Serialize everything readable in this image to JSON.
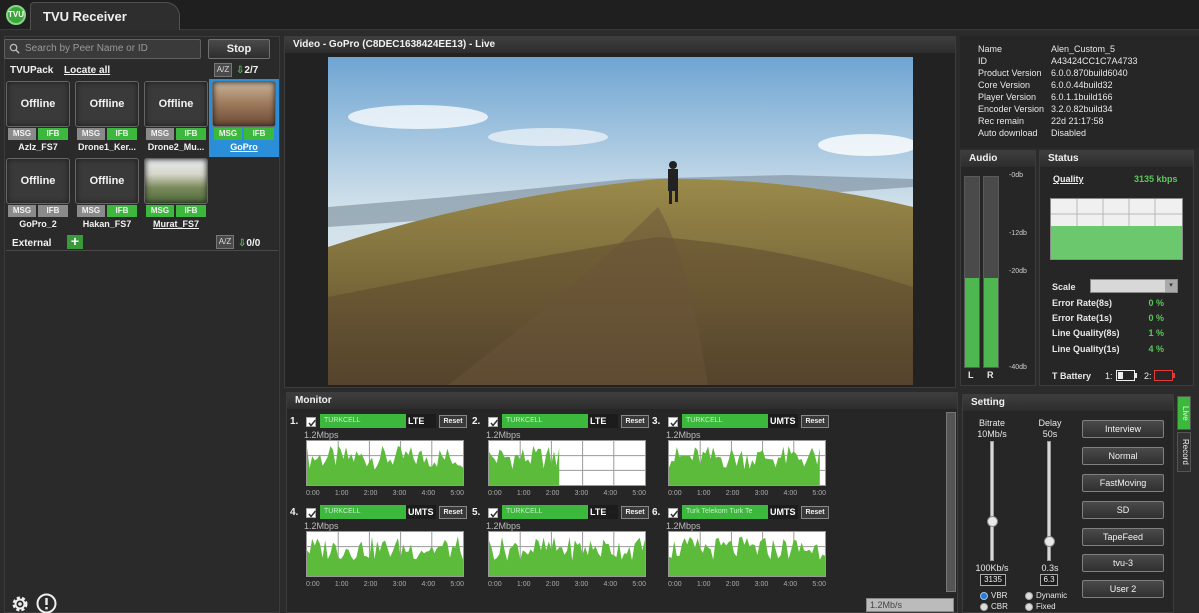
{
  "app": {
    "logo": "TVU",
    "title": "TVU Receiver"
  },
  "sidebar": {
    "search_placeholder": "Search by Peer Name or ID",
    "stop_label": "Stop",
    "tvupack_label": "TVUPack",
    "locate_label": "Locate all",
    "sort_label": "A/Z",
    "tvupack_count": "2/7",
    "external_label": "External",
    "external_count": "0/0",
    "peers": [
      {
        "status": "Offline",
        "msg": "MSG",
        "ifb": "IFB",
        "name": "Azlz_FS7"
      },
      {
        "status": "Offline",
        "msg": "MSG",
        "ifb": "IFB",
        "name": "Drone1_Ker..."
      },
      {
        "status": "Offline",
        "msg": "MSG",
        "ifb": "IFB",
        "name": "Drone2_Mu..."
      },
      {
        "status": "",
        "msg": "MSG",
        "ifb": "IFB",
        "name": "GoPro"
      },
      {
        "status": "Offline",
        "msg": "MSG",
        "ifb": "IFB",
        "name": "GoPro_2"
      },
      {
        "status": "Offline",
        "msg": "MSG",
        "ifb": "IFB",
        "name": "Hakan_FS7"
      },
      {
        "status": "",
        "msg": "MSG",
        "ifb": "IFB",
        "name": "Murat_FS7"
      }
    ]
  },
  "video": {
    "title": "Video - GoPro (C8DEC1638424EE13) - Live"
  },
  "info": [
    {
      "key": "Name",
      "value": "Alen_Custom_5"
    },
    {
      "key": "ID",
      "value": "A43424CC1C7A4733"
    },
    {
      "key": "Product Version",
      "value": "6.0.0.870build6040"
    },
    {
      "key": "Core Version",
      "value": "6.0.0.44build32"
    },
    {
      "key": "Player Version",
      "value": "6.0.1.1build166"
    },
    {
      "key": "Encoder Version",
      "value": "3.2.0.82build34"
    },
    {
      "key": "Rec remain",
      "value": "22d 21:17:58"
    },
    {
      "key": "Auto download",
      "value": "Disabled"
    }
  ],
  "audio": {
    "title": "Audio",
    "db_labels": [
      "-0db",
      "-12db",
      "-20db",
      "-40db"
    ],
    "left_label": "L",
    "right_label": "R",
    "left_level": 0.47,
    "right_level": 0.47
  },
  "status": {
    "title": "Status",
    "quality_label": "Quality",
    "quality_value": "3135 kbps",
    "quality_fill": 0.55,
    "scale_label": "Scale",
    "metrics": [
      {
        "key": "Error Rate(8s)",
        "value": "0 %"
      },
      {
        "key": "Error Rate(1s)",
        "value": "0 %"
      },
      {
        "key": "Line Quality(8s)",
        "value": "1 %"
      },
      {
        "key": "Line Quality(1s)",
        "value": "4 %"
      }
    ],
    "battery_label": "T Battery",
    "battery1_label": "1:",
    "battery2_label": "2:"
  },
  "monitor": {
    "title": "Monitor",
    "time_ticks": [
      "0:00",
      "1:00",
      "2:00",
      "3:00",
      "4:00",
      "5:00"
    ],
    "channels": [
      {
        "num": "1.",
        "carrier": "TURKCELL",
        "net": "LTE",
        "reset": "Reset",
        "rate": "1.2Mbps",
        "full": 1.0
      },
      {
        "num": "2.",
        "carrier": "TURKCELL",
        "net": "LTE",
        "reset": "Reset",
        "rate": "1.2Mbps",
        "full": 0.45
      },
      {
        "num": "3.",
        "carrier": "TURKCELL",
        "net": "UMTS",
        "reset": "Reset",
        "rate": "1.2Mbps",
        "full": 0.97
      },
      {
        "num": "4.",
        "carrier": "TURKCELL",
        "net": "UMTS",
        "reset": "Reset",
        "rate": "1.2Mbps",
        "full": 1.0
      },
      {
        "num": "5.",
        "carrier": "TURKCELL",
        "net": "LTE",
        "reset": "Reset",
        "rate": "1.2Mbps",
        "full": 1.0
      },
      {
        "num": "6.",
        "carrier": "Turk Telekom Turk Te",
        "net": "UMTS",
        "reset": "Reset",
        "rate": "1.2Mbps",
        "full": 1.0
      }
    ],
    "scale_select": "1.2Mb/s"
  },
  "setting": {
    "title": "Setting",
    "bitrate_label": "Bitrate",
    "bitrate_max": "10Mb/s",
    "bitrate_min": "100Kb/s",
    "bitrate_value": "3135",
    "delay_label": "Delay",
    "delay_max": "50s",
    "delay_min": "0.3s",
    "delay_value": "6.3",
    "vbr_label": "VBR",
    "cbr_label": "CBR",
    "dynamic_label": "Dynamic",
    "fixed_label": "Fixed",
    "presets": [
      "Interview",
      "Normal",
      "FastMoving",
      "SD",
      "TapeFeed",
      "tvu-3",
      "User 2"
    ],
    "side_tabs": [
      "Live",
      "Record"
    ]
  },
  "colors": {
    "accent_green": "#3cb83c",
    "select_blue": "#2a8fd8",
    "bg": "#2b2b2b"
  }
}
